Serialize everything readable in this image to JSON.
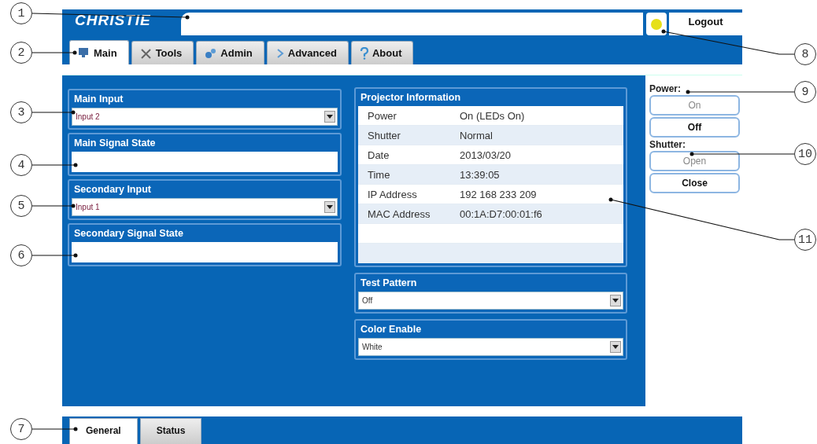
{
  "header": {
    "logo": "CHRISTIE",
    "logout_button": "Logout"
  },
  "tabs": [
    {
      "label": "Main",
      "selected": true
    },
    {
      "label": "Tools",
      "selected": false
    },
    {
      "label": "Admin",
      "selected": false
    },
    {
      "label": "Advanced",
      "selected": false
    },
    {
      "label": "About",
      "selected": false
    }
  ],
  "left_panels": [
    {
      "kind": "select",
      "title": "Main Input",
      "value": "Input 2"
    },
    {
      "kind": "state",
      "title": "Main Signal State"
    },
    {
      "kind": "select",
      "title": "Secondary Input",
      "value": "Input 1"
    },
    {
      "kind": "state",
      "title": "Secondary Signal State"
    }
  ],
  "projector_information": {
    "title": "Projector Information",
    "rows": [
      {
        "label": "Power",
        "value": "On (LEDs On)"
      },
      {
        "label": "Shutter",
        "value": "Normal"
      },
      {
        "label": "Date",
        "value": "2013/03/20"
      },
      {
        "label": "Time",
        "value": "13:39:05"
      },
      {
        "label": "IP Address",
        "value": "192 168 233 209"
      },
      {
        "label": "MAC Address",
        "value": "00:1A:D7:00:01:f6"
      }
    ]
  },
  "middle_panels": [
    {
      "kind": "select",
      "title": "Test Pattern",
      "value": "Off"
    },
    {
      "kind": "select",
      "title": "Color Enable",
      "value": "White"
    }
  ],
  "side_controls": [
    {
      "title": "Power:",
      "buttons": [
        {
          "label": "On",
          "disabled": true
        },
        {
          "label": "Off",
          "disabled": false
        }
      ]
    },
    {
      "title": "Shutter:",
      "buttons": [
        {
          "label": "Open",
          "disabled": true
        },
        {
          "label": "Close",
          "disabled": false
        }
      ]
    }
  ],
  "bottom_tabs": [
    {
      "label": "General",
      "selected": true
    },
    {
      "label": "Status",
      "selected": false
    }
  ],
  "callouts": [
    {
      "label": "1"
    },
    {
      "label": "2"
    },
    {
      "label": "3"
    },
    {
      "label": "4"
    },
    {
      "label": "5"
    },
    {
      "label": "6"
    },
    {
      "label": "7"
    },
    {
      "label": "8"
    },
    {
      "label": "9"
    },
    {
      "label": "10"
    },
    {
      "label": "11"
    }
  ]
}
